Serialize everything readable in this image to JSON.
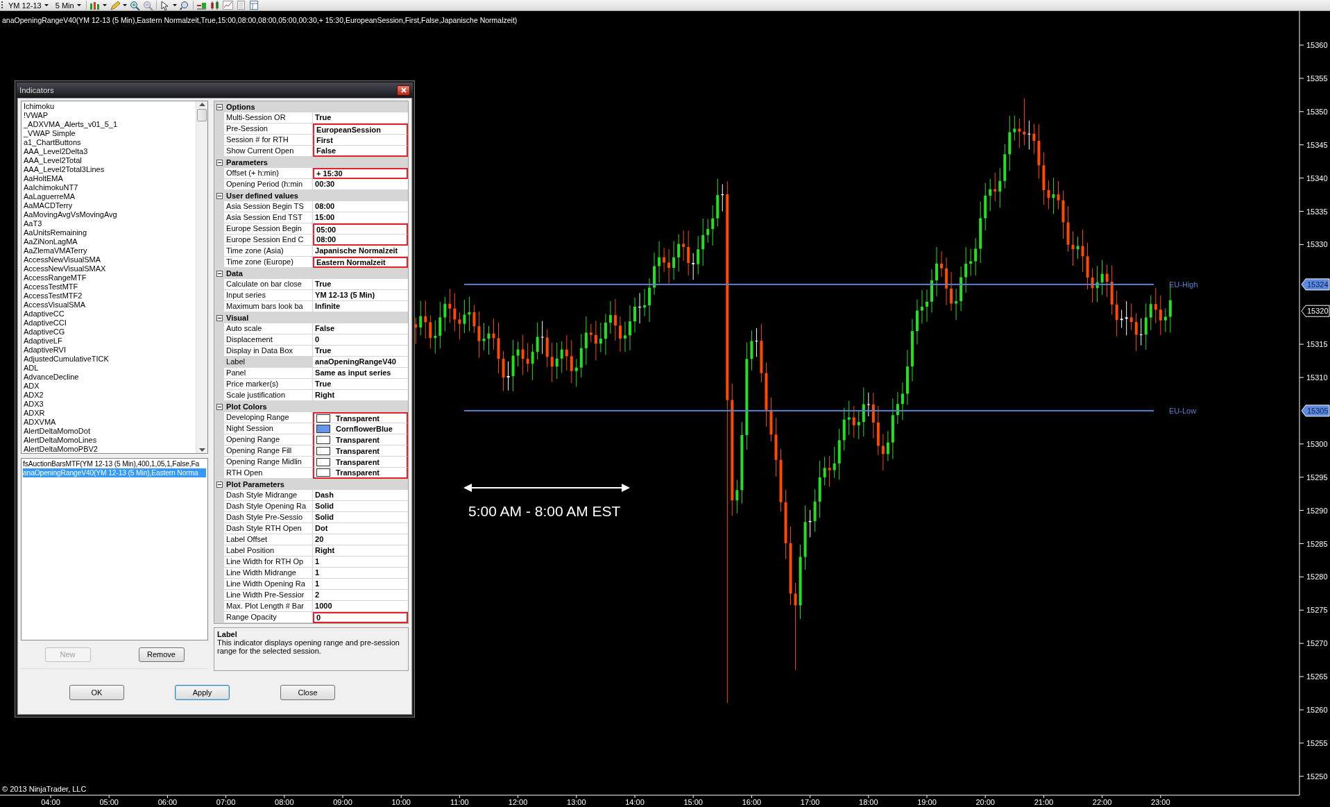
{
  "toolbar": {
    "instrument": "YM 12-13",
    "interval": "5 Min"
  },
  "chart": {
    "title": "anaOpeningRangeV40(YM 12-13 (5 Min),Eastern Normalzeit,True,15:00,08:00,08:00,05:00,00:30,+ 15:30,EuropeanSession,First,False,Japanische Normalzeit)",
    "price_ticks": [
      "15360",
      "15355",
      "15350",
      "15345",
      "15340",
      "15335",
      "15330",
      "15315",
      "15310",
      "15300",
      "15295",
      "15290",
      "15285",
      "15280",
      "15275",
      "15270",
      "15265",
      "15260",
      "15255",
      "15250"
    ],
    "time_ticks": [
      "04:00",
      "05:00",
      "06:00",
      "07:00",
      "08:00",
      "09:00",
      "10:00",
      "11:00",
      "12:00",
      "13:00",
      "14:00",
      "15:00",
      "16:00",
      "17:00",
      "18:00",
      "19:00",
      "20:00",
      "21:00",
      "22:00",
      "23:00"
    ],
    "levels": [
      {
        "label": "EU-High",
        "marker": "15324"
      },
      {
        "label": "EU-Low",
        "marker": "15305"
      }
    ],
    "last_price": "15320",
    "annotation": "5:00 AM - 8:00 AM EST",
    "copyright": "© 2013 NinjaTrader, LLC"
  },
  "dialog": {
    "title": "Indicators",
    "available": [
      "Ichimoku",
      "!VWAP",
      "_ADXVMA_Alerts_v01_5_1",
      "_VWAP Simple",
      "a1_ChartButtons",
      "AAA_Level2Delta3",
      "AAA_Level2Total",
      "AAA_Level2Total3Lines",
      "AaHoltEMA",
      "AaIchimokuNT7",
      "AaLaguerreMA",
      "AaMACDTerry",
      "AaMovingAvgVsMovingAvg",
      "AaT3",
      "AaUnitsRemaining",
      "AaZiNonLagMA",
      "AaZlemaVMATerry",
      "AccessNewVisualSMA",
      "AccessNewVisualSMAX",
      "AccessRangeMTF",
      "AccessTestMTF",
      "AccessTestMTF2",
      "AccessVisualSMA",
      "AdaptiveCC",
      "AdaptiveCCI",
      "AdaptiveCG",
      "AdaptiveLF",
      "AdaptiveRVI",
      "AdjustedCumulativeTICK",
      "ADL",
      "AdvanceDecline",
      "ADX",
      "ADX2",
      "ADX3",
      "ADXR",
      "ADXVMA",
      "AlertDeltaMomoDot",
      "AlertDeltaMomoLines",
      "AlertDeltaMomoPBV2"
    ],
    "applied": [
      {
        "text": "fsAuctionBarsMTF(YM 12-13 (5 Min),400,1,05,1,False,Fa",
        "selected": false
      },
      {
        "text": "anaOpeningRangeV40(YM 12-13 (5 Min),Eastern Norma",
        "selected": true
      }
    ],
    "list_buttons": [
      {
        "label": "New",
        "disabled": true
      },
      {
        "label": "Remove",
        "disabled": false
      }
    ],
    "categories": [
      {
        "name": "Options",
        "expanded": true,
        "items": [
          {
            "name": "Multi-Session OR",
            "value": "True",
            "selected": false,
            "highlighted": false
          },
          {
            "name": "Pre-Session",
            "value": "EuropeanSession",
            "selected": false,
            "highlighted": true
          },
          {
            "name": "Session # for RTH",
            "value": "First",
            "selected": false,
            "highlighted": true
          },
          {
            "name": "Show Current Open",
            "value": "False",
            "selected": false,
            "highlighted": true
          }
        ]
      },
      {
        "name": "Parameters",
        "expanded": true,
        "items": [
          {
            "name": "Offset (+ h:min)",
            "value": "+ 15:30",
            "selected": false,
            "highlighted": true
          },
          {
            "name": "Opening Period (h:min",
            "value": "00:30",
            "selected": false,
            "highlighted": false
          }
        ]
      },
      {
        "name": "User defined values",
        "expanded": true,
        "items": [
          {
            "name": "Asia Session Begin TS",
            "value": "08:00",
            "selected": false,
            "highlighted": false
          },
          {
            "name": "Asia Session End TST",
            "value": "15:00",
            "selected": false,
            "highlighted": false
          },
          {
            "name": "Europe Session Begin",
            "value": "05:00",
            "selected": false,
            "highlighted": true
          },
          {
            "name": "Europe Session End C",
            "value": "08:00",
            "selected": false,
            "highlighted": true
          },
          {
            "name": "Time zone (Asia)",
            "value": "Japanische Normalzeit",
            "selected": false,
            "highlighted": false
          },
          {
            "name": "Time zone (Europe)",
            "value": "Eastern Normalzeit",
            "selected": false,
            "highlighted": true
          }
        ]
      },
      {
        "name": "Data",
        "expanded": true,
        "items": [
          {
            "name": "Calculate on bar close",
            "value": "True",
            "selected": false,
            "highlighted": false
          },
          {
            "name": "Input series",
            "value": "YM 12-13 (5 Min)",
            "selected": false,
            "highlighted": false
          },
          {
            "name": "Maximum bars look ba",
            "value": "Infinite",
            "selected": false,
            "highlighted": false
          }
        ]
      },
      {
        "name": "Visual",
        "expanded": true,
        "items": [
          {
            "name": "Auto scale",
            "value": "False",
            "selected": false,
            "highlighted": false
          },
          {
            "name": "Displacement",
            "value": "0",
            "selected": false,
            "highlighted": false
          },
          {
            "name": "Display in Data Box",
            "value": "True",
            "selected": false,
            "highlighted": false
          },
          {
            "name": "Label",
            "value": "anaOpeningRangeV40",
            "selected": true,
            "highlighted": false
          },
          {
            "name": "Panel",
            "value": "Same as input series",
            "selected": false,
            "highlighted": false
          },
          {
            "name": "Price marker(s)",
            "value": "True",
            "selected": false,
            "highlighted": false
          },
          {
            "name": "Scale justification",
            "value": "Right",
            "selected": false,
            "highlighted": false
          }
        ]
      },
      {
        "name": "Plot Colors",
        "expanded": true,
        "items": [
          {
            "name": "Developing Range",
            "value": "Transparent",
            "color": "#ffffff",
            "selected": false,
            "highlighted": true
          },
          {
            "name": "Night Session",
            "value": "CornflowerBlue",
            "color": "#6495ed",
            "selected": false,
            "highlighted": true
          },
          {
            "name": "Opening Range",
            "value": "Transparent",
            "color": "#ffffff",
            "selected": false,
            "highlighted": true
          },
          {
            "name": "Opening Range Fill",
            "value": "Transparent",
            "color": "#ffffff",
            "selected": false,
            "highlighted": true
          },
          {
            "name": "Opening Range Midlin",
            "value": "Transparent",
            "color": "#ffffff",
            "selected": false,
            "highlighted": true
          },
          {
            "name": "RTH Open",
            "value": "Transparent",
            "color": "#ffffff",
            "selected": false,
            "highlighted": true
          }
        ]
      },
      {
        "name": "Plot Parameters",
        "expanded": true,
        "items": [
          {
            "name": "Dash Style Midrange",
            "value": "Dash",
            "selected": false,
            "highlighted": false
          },
          {
            "name": "Dash Style Opening Ra",
            "value": "Solid",
            "selected": false,
            "highlighted": false
          },
          {
            "name": "Dash Style Pre-Sessio",
            "value": "Solid",
            "selected": false,
            "highlighted": false
          },
          {
            "name": "Dash Style RTH Open",
            "value": "Dot",
            "selected": false,
            "highlighted": false
          },
          {
            "name": "Label Offset",
            "value": "20",
            "selected": false,
            "highlighted": false
          },
          {
            "name": "Label Position",
            "value": "Right",
            "selected": false,
            "highlighted": false
          },
          {
            "name": "Line Width for RTH Op",
            "value": "1",
            "selected": false,
            "highlighted": false
          },
          {
            "name": "Line Width Midrange",
            "value": "1",
            "selected": false,
            "highlighted": false
          },
          {
            "name": "Line Width Opening Ra",
            "value": "1",
            "selected": false,
            "highlighted": false
          },
          {
            "name": "Line Width Pre-Sessior",
            "value": "2",
            "selected": false,
            "highlighted": false
          },
          {
            "name": "Max. Plot Length # Bar",
            "value": "1000",
            "selected": false,
            "highlighted": false
          },
          {
            "name": "Range Opacity",
            "value": "0",
            "selected": false,
            "highlighted": true
          }
        ]
      }
    ],
    "description": {
      "title": "Label",
      "text": "This indicator displays opening range and pre-session range for the selected session."
    },
    "footer_buttons": [
      {
        "label": "OK",
        "focused": false
      },
      {
        "label": "Apply",
        "focused": true
      },
      {
        "label": "Close",
        "focused": false
      }
    ]
  }
}
